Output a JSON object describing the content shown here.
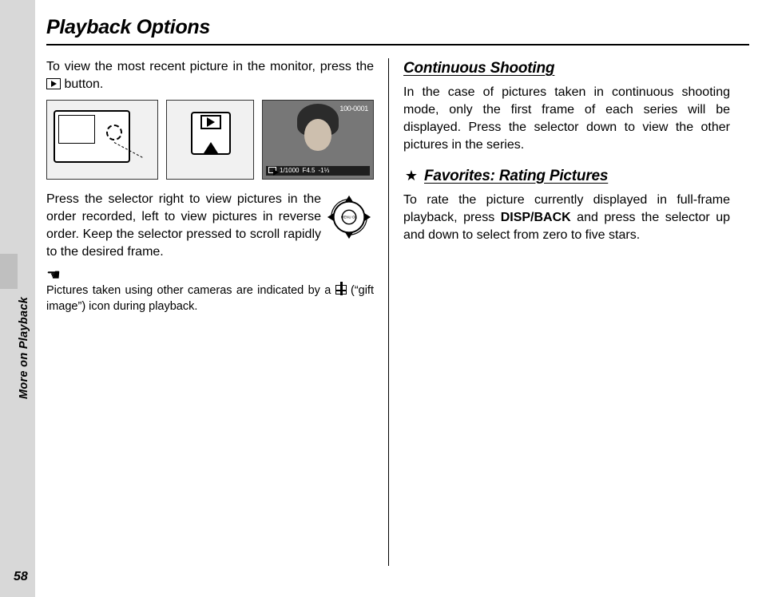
{
  "page_number": "58",
  "sidebar_label": "More on Playback",
  "title": "Playback Options",
  "left": {
    "intro_a": "To view the most recent picture in the monitor, press the ",
    "intro_b": " button.",
    "selector_text": "Press the selector right to view pictures in the order recorded, left to view pictures in reverse order. Keep the selector pressed to scroll rapidly to the desired frame.",
    "note_a": "Pictures taken using other cameras are indicated by a ",
    "note_b": " (“gift image”) icon during playback.",
    "sample_top": "100-0001",
    "sample_shutter": "1/1000",
    "sample_ap": "F4.5",
    "sample_ev": "-1⅓"
  },
  "right": {
    "h_cont": "Continuous Shooting",
    "cont_text": "In the case of pictures taken in continuous shooting mode, only the first frame of each series will be displayed. Press the selector down to view the other pictures in the series.",
    "h_fav": "Favorites: Rating Pictures",
    "fav_a": "To rate the picture currently displayed in full-frame playback, press ",
    "fav_key": "DISP/BACK",
    "fav_b": " and press the selector up and down to select from zero to five stars."
  }
}
